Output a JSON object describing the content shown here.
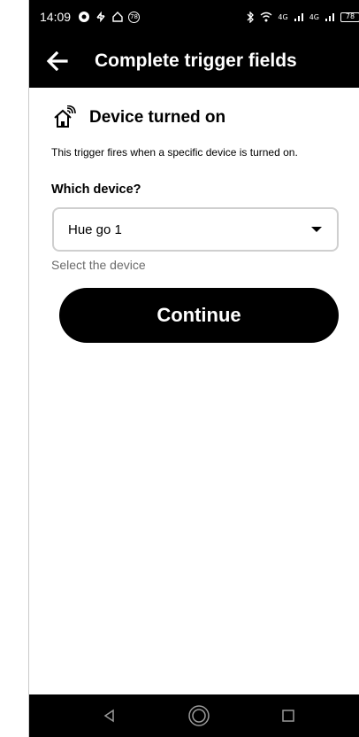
{
  "status_bar": {
    "time": "14:09",
    "notification_badge": "78",
    "network_label_1": "4G",
    "network_label_2": "4G",
    "battery": "78"
  },
  "header": {
    "title": "Complete trigger fields"
  },
  "trigger": {
    "icon": "smart-home-icon",
    "title": "Device turned on",
    "description": "This trigger fires when a specific device is turned on."
  },
  "field": {
    "label": "Which device?",
    "selected_value": "Hue go 1",
    "helper": "Select the device"
  },
  "actions": {
    "continue_label": "Continue"
  },
  "colors": {
    "bar_background": "#000000",
    "page_background": "#ffffff",
    "helper_text": "#6b6b6b",
    "select_border": "#cfcfcf"
  }
}
